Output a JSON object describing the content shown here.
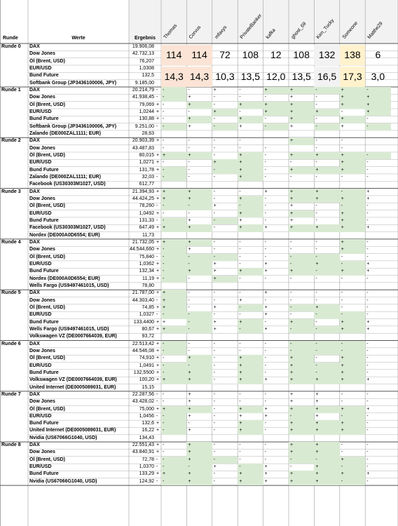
{
  "headers": {
    "runde": "Runde",
    "werte": "Werte",
    "ergebnis": "Ergebnis"
  },
  "players": [
    {
      "name": "Thomas",
      "score": "114",
      "avg": "14,3",
      "tint": "#fbe4d5"
    },
    {
      "name": "Corvus",
      "score": "114",
      "avg": "14,3",
      "tint": "#fbe4d5"
    },
    {
      "name": "mfaxys",
      "score": "72",
      "avg": "10,3",
      "tint": ""
    },
    {
      "name": "PrivateBanker",
      "score": "108",
      "avg": "13,5",
      "tint": ""
    },
    {
      "name": "kafka",
      "score": "12",
      "avg": "12,0",
      "tint": ""
    },
    {
      "name": "ghost_69",
      "score": "108",
      "avg": "13,5",
      "tint": ""
    },
    {
      "name": "Ken_Tucky",
      "score": "132",
      "avg": "16,5",
      "tint": "#f2f2f2"
    },
    {
      "name": "Someone",
      "score": "138",
      "avg": "17,3",
      "tint": "#fff2cc"
    },
    {
      "name": "Matthe29",
      "score": "6",
      "avg": "3,0",
      "tint": ""
    }
  ],
  "colors": {
    "green": "#d9ead3",
    "grid": "#9e9e9e",
    "header_bg": "#f2f2f2"
  },
  "rounds": [
    {
      "label": "Runde 0",
      "rows": [
        {
          "w": "DAX",
          "v": "19.906,08",
          "s": "",
          "m": "",
          "g": ""
        },
        {
          "w": "Dow Jones",
          "v": "42.732,13",
          "s": "",
          "m": "",
          "g": ""
        },
        {
          "w": "Öl (Brent, USD)",
          "v": "76,207",
          "s": "",
          "m": "",
          "g": ""
        },
        {
          "w": "EUR/USD",
          "v": "1,0308",
          "s": "",
          "m": "",
          "g": ""
        },
        {
          "w": "Bund Future",
          "v": "132,5",
          "s": "",
          "m": "",
          "g": ""
        },
        {
          "w": "Softbank Group (JP3436100006, JPY)",
          "v": "9.185,00",
          "s": "",
          "m": "",
          "g": ""
        }
      ]
    },
    {
      "label": "Runde 1",
      "rows": [
        {
          "w": "DAX",
          "v": "20.214,79",
          "s": "-",
          "m": "--+-++-+-",
          "g": "1,0,0,0,1,1,1,1,1"
        },
        {
          "w": "Dow Jones",
          "v": "41.938,45",
          "s": "-",
          "m": "-+---+-++",
          "g": "1,0,0,0,0,0,0,1,1"
        },
        {
          "w": "Öl (Brent, USD)",
          "v": "79,069",
          "s": "+",
          "m": "-+-+++-++",
          "g": "0,1,0,1,1,1,0,1,1"
        },
        {
          "w": "EUR/USD",
          "v": "1,0244",
          "s": "+",
          "m": "--+-+++-+",
          "g": "0,0,1,0,1,1,1,0,1"
        },
        {
          "w": "Bund Future",
          "v": "130,88",
          "s": "+",
          "m": "-+-+-+-+-",
          "g": "0,1,0,1,0,1,0,1,0"
        },
        {
          "w": "Softbank Group (JP3436100006, JPY)",
          "v": "9.251,00",
          "s": "-",
          "m": "-+-+-+-+-",
          "g": "1,0,1,0,1,0,1,0,1"
        },
        {
          "w": "Zalando (DE000ZAL1111; EUR)",
          "v": "28,63",
          "s": "",
          "m": "",
          "g": ""
        }
      ]
    },
    {
      "label": "Runde 2",
      "rows": [
        {
          "w": "DAX",
          "v": "20.903,39",
          "s": "+",
          "m": "---- +-- ",
          "g": "0,0,0,0,0,1,0,0,0"
        },
        {
          "w": "Dow Jones",
          "v": "43.487,83",
          "s": "",
          "m": "----- -- ",
          "g": ""
        },
        {
          "w": "Öl (Brent, USD)",
          "v": "80,015",
          "s": "+",
          "m": "++-+-+++-",
          "g": "1,1,0,1,0,1,1,1,1"
        },
        {
          "w": "EUR/USD",
          "v": "1,0271",
          "s": "+",
          "m": "--++---+-",
          "g": "0,0,1,1,0,0,0,1,0"
        },
        {
          "w": "Bund Future",
          "v": "131,78",
          "s": "+",
          "m": "---+-+++-",
          "g": "1,0,1,1,0,1,1,1,0"
        },
        {
          "w": "Zalando (DE000ZAL1111; EUR)",
          "v": "32,03",
          "s": "-",
          "m": "---+-----",
          "g": "1,0,0,1,0,0,0,0,0"
        },
        {
          "w": "Facebook (US30303M1027, USD)",
          "v": "612,77",
          "s": "",
          "m": "",
          "g": ""
        }
      ]
    },
    {
      "label": "Runde 3",
      "rows": [
        {
          "w": "DAX",
          "v": "21.394,93",
          "s": "+",
          "m": "++--+++-+",
          "g": "1,1,0,0,0,1,1,1,0"
        },
        {
          "w": "Dow Jones",
          "v": "44.424,25",
          "s": "+",
          "m": "++-+-++++",
          "g": "1,1,0,1,0,1,1,1,0"
        },
        {
          "w": "Öl (Brent, USD)",
          "v": "78,260",
          "s": "-",
          "m": "--+--+---",
          "g": "1,1,0,1,0,0,0,1,0"
        },
        {
          "w": "EUR/USD",
          "v": "1,0492",
          "s": "+",
          "m": "---+-+-+-",
          "g": "0,0,0,1,0,1,0,1,0"
        },
        {
          "w": "Bund Future",
          "v": "131,33",
          "s": "-",
          "m": "-+-+-+-+-",
          "g": "1,0,1,0,0,0,0,1,0"
        },
        {
          "w": "Facebook (US30303M1027, USD)",
          "v": "647,49",
          "s": "+",
          "m": "++-++++++",
          "g": "1,1,0,1,0,1,1,1,0"
        },
        {
          "w": "Nordex (DE000A0D6554; EUR)",
          "v": "11,73",
          "s": "",
          "m": "",
          "g": ""
        }
      ]
    },
    {
      "label": "Runde 4",
      "rows": [
        {
          "w": "DAX",
          "v": "21.732,05",
          "s": "+",
          "m": "++-----+-",
          "g": "1,1,0,0,0,0,0,1,0"
        },
        {
          "w": "Dow Jones",
          "v": "44.544,660",
          "s": "+",
          "m": "-+-----+-",
          "g": "1,0,0,0,0,0,0,1,0"
        },
        {
          "w": "Öl (Brent, USD)",
          "v": "75,840",
          "s": "-",
          "m": "---------",
          "g": "1,1,1,0,0,1,1,0,0"
        },
        {
          "w": "EUR/USD",
          "v": "1,0362",
          "s": "+",
          "m": "--+-+-+-+",
          "g": "1,1,0,0,0,1,1,1,0"
        },
        {
          "w": "Bund Future",
          "v": "132,34",
          "s": "+",
          "m": "-+++++-++",
          "g": "1,1,0,1,0,1,1,1,0"
        },
        {
          "w": "Nordex (DE000A0D6554; EUR)",
          "v": "11,19",
          "s": "+",
          "m": "--+------",
          "g": "1,0,1,0,0,0,0,0,0"
        },
        {
          "w": "Wells Fargo (US9497461015, USD)",
          "v": "78,80",
          "s": "",
          "m": "",
          "g": ""
        }
      ]
    },
    {
      "label": "Runde 5",
      "rows": [
        {
          "w": "DAX",
          "v": "21.787,00",
          "s": "+",
          "m": "+---+----",
          "g": "1,0,0,0,0,0,0,0,0"
        },
        {
          "w": "Dow Jones",
          "v": "44.303,40",
          "s": "-",
          "m": "+--+-----",
          "g": "1,0,0,0,0,0,0,0,0"
        },
        {
          "w": "Öl (Brent, USD)",
          "v": "74,85",
          "s": "+",
          "m": "+-+-+-+--",
          "g": "1,0,0,1,0,1,1,0,0"
        },
        {
          "w": "EUR/USD",
          "v": "1,0327",
          "s": "-",
          "m": "----+----",
          "g": "1,1,0,0,0,0,1,1,0"
        },
        {
          "w": "Bund Future",
          "v": "133,4400",
          "s": "+",
          "m": "+-++-+-++",
          "g": "0,1,0,1,0,1,0,1,0"
        },
        {
          "w": "Wells Fargo (US9497461015, USD)",
          "v": "80,67",
          "s": "+",
          "m": "+-+-+--++",
          "g": "1,1,0,1,0,1,1,1,0"
        },
        {
          "w": "Volkswagen VZ (DE0007664039, EUR)",
          "v": "93,72",
          "s": "",
          "m": "",
          "g": ""
        }
      ]
    },
    {
      "label": "Runde 6",
      "rows": [
        {
          "w": "DAX",
          "v": "22.513,42",
          "s": "+",
          "m": "---------",
          "g": "1,0,0,0,0,1,1,1,0"
        },
        {
          "w": "Dow Jones",
          "v": "44.546,08",
          "s": "+",
          "m": "---------",
          "g": "1,0,0,0,0,1,1,1,0"
        },
        {
          "w": "Öl (Brent, USD)",
          "v": "74,910",
          "s": "+",
          "m": "-+-+-+-+-",
          "g": "0,1,0,1,0,1,0,1,0"
        },
        {
          "w": "EUR/USD",
          "v": "1,0491",
          "s": "+",
          "m": "---+-+-+-",
          "g": "1,1,0,1,0,1,1,1,0"
        },
        {
          "w": "Bund Future",
          "v": "132,5500",
          "s": "+",
          "m": "-+-+-+-+-",
          "g": "1,1,0,1,0,1,1,1,0"
        },
        {
          "w": "Volkswagen VZ (DE0007664039, EUR)",
          "v": "100,20",
          "s": "+",
          "m": "++-++++++",
          "g": "1,1,0,1,0,1,1,1,0"
        },
        {
          "w": "United Internet (DE0005089031, EUR)",
          "v": "15,15",
          "s": "",
          "m": "",
          "g": ""
        }
      ]
    },
    {
      "label": "Runde 7",
      "rows": [
        {
          "w": "DAX",
          "v": "22.287,56",
          "s": "-",
          "m": "-+---++--",
          "g": "0,0,0,0,0,0,0,0,0"
        },
        {
          "w": "Dow Jones",
          "v": "43.428,02",
          "s": "-",
          "m": "-+---++--",
          "g": "0,0,0,0,0,0,0,0,0"
        },
        {
          "w": "Öl (Brent, USD)",
          "v": "75,000",
          "s": "+",
          "m": "++-++++++",
          "g": "1,1,0,1,0,1,1,1,0"
        },
        {
          "w": "EUR/USD",
          "v": "1,0456",
          "s": "-",
          "m": "-+-++-+--",
          "g": "1,0,0,0,0,1,0,1,0"
        },
        {
          "w": "Bund Future",
          "v": "132,6",
          "s": "+",
          "m": "---+-+++-",
          "g": "1,0,0,1,0,1,1,1,0"
        },
        {
          "w": "United Internet (DE0005089031, EUR)",
          "v": "16,22",
          "s": "+",
          "m": "-+-+-+++-",
          "g": "1,0,0,1,0,1,1,1,0"
        },
        {
          "w": "Nvidia (US67066G1040, USD)",
          "v": "134,43",
          "s": "",
          "m": "",
          "g": ""
        }
      ]
    },
    {
      "label": "Runde 8",
      "rows": [
        {
          "w": "DAX",
          "v": "22.551,43",
          "s": "+",
          "m": "-+---++--",
          "g": "0,1,0,0,0,1,1,0,0"
        },
        {
          "w": "Dow Jones",
          "v": "43.840,91",
          "s": "+",
          "m": "-+---++--",
          "g": "0,1,0,0,0,1,1,0,0"
        },
        {
          "w": "Öl (Brent, USD)",
          "v": "72,78",
          "s": "-",
          "m": "-+-----+-",
          "g": "1,1,1,0,0,1,1,1,0"
        },
        {
          "w": "EUR/USD",
          "v": "1,0370",
          "s": "-",
          "m": "--+-+-+--",
          "g": "1,1,0,1,0,0,1,1,0"
        },
        {
          "w": "Bund Future",
          "v": "133,29",
          "s": "+",
          "m": "++-++++++",
          "g": "1,1,0,1,0,1,1,1,0"
        },
        {
          "w": "Nvidia (US67066G1040, USD)",
          "v": "124,92",
          "s": "-",
          "m": "-+-++++--",
          "g": "1,1,0,1,0,1,1,1,0"
        }
      ]
    }
  ]
}
